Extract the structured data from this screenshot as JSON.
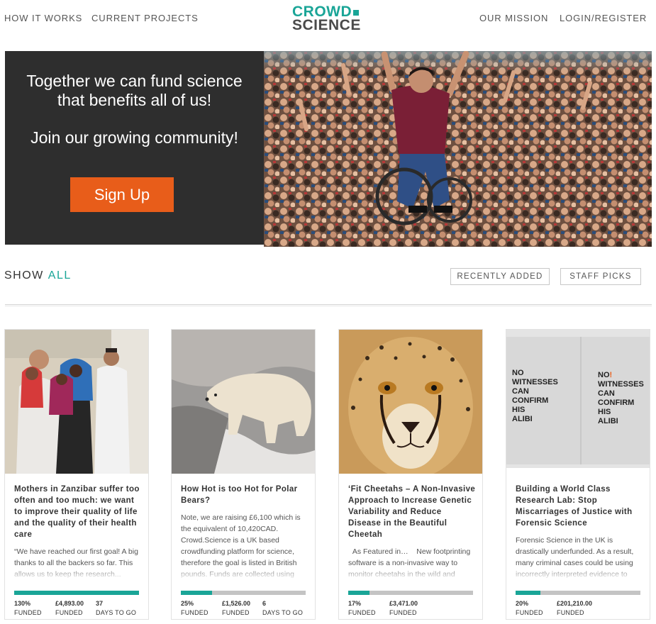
{
  "nav": {
    "how_it_works": "HOW IT WORKS",
    "current_projects": "CURRENT PROJECTS",
    "our_mission": "OUR MISSION",
    "login_register": "LOGIN/REGISTER"
  },
  "logo": {
    "line1": "CROWD",
    "line2": "SCIENCE"
  },
  "hero": {
    "line1": "Together we can fund science",
    "line2": "that benefits all of us!",
    "line3": "Join our growing community!",
    "signup": "Sign Up"
  },
  "filters": {
    "show": "SHOW",
    "all": "ALL",
    "recently_added": "RECENTLY ADDED",
    "staff_picks": "STAFF PICKS"
  },
  "projects": [
    {
      "title": "Mothers in Zanzibar suffer too often and too much: we want to improve their quality of life and the quality of their health care",
      "excerpt": "“We have reached our first goal! A big thanks to all the backers so far. This allows us to keep the research...",
      "funded_fraction": 1.0,
      "percent": "130%",
      "percent_label": "FUNDED",
      "amount": "£4,893.00",
      "amount_label": "FUNDED",
      "days": "37",
      "days_label": "DAYS TO GO"
    },
    {
      "title": "How Hot is too Hot for Polar Bears?",
      "excerpt": "Note, we are raising £6,100 which is the equivalent of 10,420CAD. Crowd.Science is a UK based crowdfunding platform for science, therefore the goal is listed in British pounds. Funds are collected using",
      "funded_fraction": 0.25,
      "percent": "25%",
      "percent_label": "FUNDED",
      "amount": "£1,526.00",
      "amount_label": "FUNDED",
      "days": "6",
      "days_label": "DAYS TO GO"
    },
    {
      "title": "‘Fit Cheetahs – A Non-Invasive Approach to Increase Genetic Variability and Reduce Disease in the Beautiful Cheetah",
      "excerpt": "  As Featured in…    New footprinting software is a non-invasive way to monitor cheetahs in the wild and",
      "funded_fraction": 0.17,
      "percent": "17%",
      "percent_label": "FUNDED",
      "amount": "£3,471.00",
      "amount_label": "FUNDED",
      "days": "",
      "days_label": ""
    },
    {
      "title": "Building a World Class Research Lab: Stop Miscarriages of Justice with Forensic Science",
      "excerpt": "Forensic Science in the UK is drastically underfunded. As a result, many criminal cases could be using incorrectly interpreted evidence to",
      "funded_fraction": 0.2,
      "percent": "20%",
      "percent_label": "FUNDED",
      "amount": "£201,210.00",
      "amount_label": "FUNDED",
      "days": "",
      "days_label": ""
    }
  ],
  "poster": {
    "left": [
      "NO",
      "WITNESSES",
      "CAN",
      "CONFIRM",
      "HIS",
      "ALIBI"
    ],
    "right_no": "NO",
    "right_mark": "!",
    "right": [
      "WITNESSES",
      "CAN",
      "CONFIRM",
      "HIS",
      "ALIBI"
    ]
  },
  "colors": {
    "accent": "#1aa597",
    "signup": "#e85d1a",
    "hero_panel": "#2e2e2e",
    "poster_mark": "#e85d1a"
  }
}
